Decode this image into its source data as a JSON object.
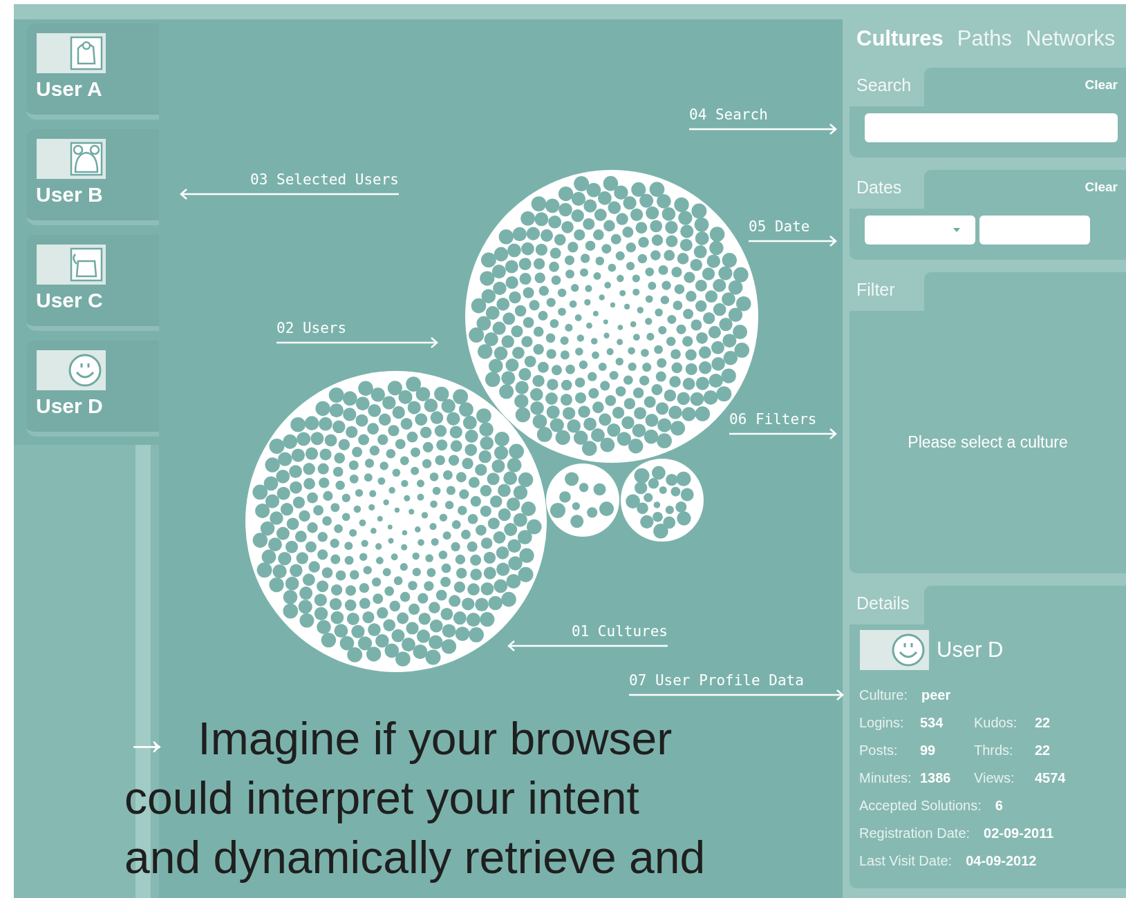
{
  "users": [
    {
      "name": "User A"
    },
    {
      "name": "User B"
    },
    {
      "name": "User C"
    },
    {
      "name": "User D"
    }
  ],
  "annotations": [
    {
      "label": "04 Search"
    },
    {
      "label": "03 Selected Users"
    },
    {
      "label": "05 Date"
    },
    {
      "label": "02 Users"
    },
    {
      "label": "06 Filters"
    },
    {
      "label": "01 Cultures"
    },
    {
      "label": "07 User Profile Data"
    }
  ],
  "headline": "→ Imagine if your browser could interpret your intent and dynamically retrieve and",
  "tabs": [
    {
      "label": "Cultures",
      "selected": true
    },
    {
      "label": "Paths",
      "selected": false
    },
    {
      "label": "Networks",
      "selected": false
    }
  ],
  "search": {
    "title": "Search",
    "clear": "Clear"
  },
  "dates": {
    "title": "Dates",
    "clear": "Clear"
  },
  "filter": {
    "title": "Filter",
    "message": "Please select a culture"
  },
  "details": {
    "title": "Details",
    "user": {
      "name": "User D"
    },
    "rows": [
      [
        {
          "label": "Culture:",
          "value": "peer"
        }
      ],
      [
        {
          "label": "Logins:",
          "value": "534"
        },
        {
          "label": "Kudos:",
          "value": "22"
        }
      ],
      [
        {
          "label": "Posts:",
          "value": "99"
        },
        {
          "label": "Thrds:",
          "value": "22"
        }
      ],
      [
        {
          "label": "Minutes:",
          "value": "1386"
        },
        {
          "label": "Views:",
          "value": "4574"
        }
      ],
      [
        {
          "label": "Accepted Solutions:",
          "value": "6"
        }
      ],
      [
        {
          "label": "Registration Date:",
          "value": "02-09-2011"
        }
      ],
      [
        {
          "label": "Last Visit Date:",
          "value": "04-09-2012"
        }
      ]
    ]
  }
}
